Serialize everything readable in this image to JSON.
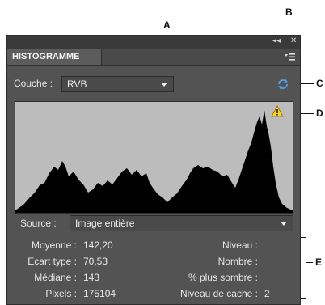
{
  "callouts": {
    "a": "A",
    "b": "B",
    "c": "C",
    "d": "D",
    "e": "E"
  },
  "panel": {
    "tab_title": "HISTOGRAMME",
    "channel_label": "Couche :",
    "channel_value": "RVB",
    "source_label": "Source :",
    "source_value": "Image entière"
  },
  "stats_left": [
    {
      "label": "Moyenne :",
      "value": "142,20"
    },
    {
      "label": "Ecart type :",
      "value": "70,53"
    },
    {
      "label": "Médiane :",
      "value": "143"
    },
    {
      "label": "Pixels :",
      "value": "175104"
    }
  ],
  "stats_right": [
    {
      "label": "Niveau :",
      "value": ""
    },
    {
      "label": "Nombre :",
      "value": ""
    },
    {
      "label": "% plus sombre :",
      "value": ""
    },
    {
      "label": "Niveau de cache :",
      "value": "2"
    }
  ],
  "icons": {
    "refresh": "refresh-icon",
    "warning": "warning-icon",
    "panel_menu": "panel-menu-icon",
    "collapse": "collapse-icon",
    "close": "close-icon"
  },
  "colors": {
    "panel_bg": "#535353",
    "histogram_bg": "#bcbcbc",
    "histogram_fill": "#000000",
    "refresh": "#4aa3f0",
    "warning": "#ffd21e"
  }
}
